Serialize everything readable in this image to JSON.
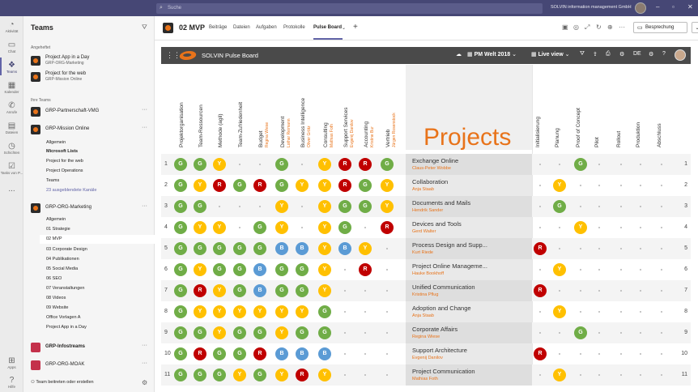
{
  "topbar": {
    "search_placeholder": "Suche",
    "org": "SOLVIN information management GmbH"
  },
  "rail": [
    {
      "label": "Aktivität",
      "icon": "bell-icon"
    },
    {
      "label": "Chat",
      "icon": "chat-icon"
    },
    {
      "label": "Teams",
      "icon": "teams-icon"
    },
    {
      "label": "Kalender",
      "icon": "calendar-icon"
    },
    {
      "label": "Anrufe",
      "icon": "phone-icon"
    },
    {
      "label": "Dateien",
      "icon": "files-icon"
    },
    {
      "label": "Schichten",
      "icon": "shifts-icon"
    },
    {
      "label": "Tasks von P...",
      "icon": "tasks-icon"
    },
    {
      "label": "...",
      "icon": "more-icon"
    },
    {
      "label": "Apps",
      "icon": "apps-icon"
    },
    {
      "label": "Hilfe",
      "icon": "help-icon"
    }
  ],
  "teams_panel": {
    "title": "Teams",
    "pinned_label": "Angeheftet",
    "pinned": [
      {
        "name": "Project App in a Day",
        "sub": "GRP-ORG-Marketing"
      },
      {
        "name": "Project for the web",
        "sub": "GRP-Mission Online"
      }
    ],
    "your_teams_label": "Ihre Teams",
    "team1": "GRP-Partnerschaft-VMG",
    "team2": "GRP-Mission Online",
    "team2_channels": [
      "Allgemein",
      "Microsoft Lists",
      "Project for the web",
      "Project Operations",
      "Teams",
      "23 ausgeblendete Kanäle"
    ],
    "team3": "GRP-ORG-Marketing",
    "team3_channels": [
      "Allgemein",
      "01 Strategie",
      "02 MVP",
      "03 Corporate Design",
      "04 Publikationen",
      "05 Social Media",
      "06 SEO",
      "07 Veranstaltungen",
      "08 Videos",
      "09 Website",
      "Office Vorlagen A",
      "Project App in a Day"
    ],
    "team4": "GRP-Infostreams",
    "team5": "GRP-ORG-MOAK",
    "join": "Team beitreten oder erstellen"
  },
  "header": {
    "title": "02 MVP",
    "tabs": [
      "Beiträge",
      "Dateien",
      "Aufgaben",
      "Protokolle",
      "Pulse Board"
    ],
    "meeting": "Besprechung"
  },
  "pulse": {
    "title": "SOLVIN Pulse Board",
    "portfolio": "PM Welt 2018",
    "view": "Live view",
    "lang": "DE",
    "projects_heading": "Projects",
    "columns": [
      {
        "label": "Projektorganisation",
        "person": ""
      },
      {
        "label": "Team-Ressourcen",
        "person": ""
      },
      {
        "label": "Methode (agil)",
        "person": ""
      },
      {
        "label": "Team-Zufriedenheit",
        "person": ""
      },
      {
        "label": "Budget",
        "person": "Regina Wiese"
      },
      {
        "label": "Development",
        "person": "Lothar Reimann"
      },
      {
        "label": "Business Intelligence",
        "person": "Oliver Grötz"
      },
      {
        "label": "Consulting",
        "person": "Mathias Foth"
      },
      {
        "label": "Support Services",
        "person": "Evgenij Danilov"
      },
      {
        "label": "Accounting",
        "person": "Kristine Bur"
      },
      {
        "label": "Vertrieb",
        "person": "Jürgen Rosenstock"
      }
    ],
    "phases": [
      "Initialisierung",
      "Planung",
      "Proof of Concept",
      "Pilot",
      "Rollout",
      "Produktion",
      "Abschluss"
    ],
    "rows": [
      {
        "n": "1",
        "name": "Exchange Online",
        "pm": "Claus-Peter Wobbe",
        "cells": [
          "G",
          "G",
          "Y",
          "",
          "",
          "G",
          "",
          "Y",
          "R",
          "R",
          "G"
        ],
        "phase": [
          "",
          "",
          "G",
          "",
          "",
          "",
          ""
        ]
      },
      {
        "n": "2",
        "name": "Collaboration",
        "pm": "Anja Staab",
        "cells": [
          "G",
          "Y",
          "R",
          "G",
          "R",
          "G",
          "Y",
          "Y",
          "R",
          "G",
          "Y"
        ],
        "phase": [
          "",
          "Y",
          "",
          "",
          "",
          "",
          ""
        ]
      },
      {
        "n": "3",
        "name": "Documents and Mails",
        "pm": "Hendrik Sander",
        "cells": [
          "G",
          "G",
          "",
          "",
          "",
          "Y",
          "",
          "Y",
          "G",
          "G",
          "Y"
        ],
        "phase": [
          "",
          "G",
          "",
          "",
          "",
          "",
          ""
        ]
      },
      {
        "n": "4",
        "name": "Devices and Tools",
        "pm": "Gerd Walter",
        "cells": [
          "G",
          "Y",
          "Y",
          "",
          "G",
          "Y",
          "",
          "Y",
          "G",
          "",
          "R"
        ],
        "phase": [
          "",
          "",
          "Y",
          "",
          "",
          "",
          ""
        ]
      },
      {
        "n": "5",
        "name": "Process Design and Supp...",
        "pm": "Kurt Riede",
        "cells": [
          "G",
          "G",
          "G",
          "G",
          "G",
          "B",
          "B",
          "Y",
          "B",
          "Y",
          ""
        ],
        "phase": [
          "R",
          "",
          "",
          "",
          "",
          "",
          ""
        ]
      },
      {
        "n": "6",
        "name": "Project Online Manageme...",
        "pm": "Hauke Bookhoff",
        "cells": [
          "G",
          "Y",
          "G",
          "G",
          "B",
          "G",
          "G",
          "Y",
          "",
          "R",
          ""
        ],
        "phase": [
          "",
          "Y",
          "",
          "",
          "",
          "",
          ""
        ]
      },
      {
        "n": "7",
        "name": "Unified Communication",
        "pm": "Kristina Pflug",
        "cells": [
          "G",
          "R",
          "Y",
          "G",
          "B",
          "G",
          "G",
          "Y",
          "",
          "",
          ""
        ],
        "phase": [
          "R",
          "",
          "",
          "",
          "",
          "",
          ""
        ]
      },
      {
        "n": "8",
        "name": "Adoption and Change",
        "pm": "Anja Staab",
        "cells": [
          "G",
          "Y",
          "Y",
          "Y",
          "Y",
          "Y",
          "Y",
          "G",
          "",
          "",
          ""
        ],
        "phase": [
          "",
          "Y",
          "",
          "",
          "",
          "",
          ""
        ]
      },
      {
        "n": "9",
        "name": "Corporate Affairs",
        "pm": "Regina Wiese",
        "cells": [
          "G",
          "G",
          "Y",
          "G",
          "G",
          "Y",
          "G",
          "G",
          "",
          "",
          ""
        ],
        "phase": [
          "",
          "",
          "G",
          "",
          "",
          "",
          ""
        ]
      },
      {
        "n": "10",
        "name": "Support Architecture",
        "pm": "Evgenij Danilov",
        "cells": [
          "G",
          "R",
          "G",
          "G",
          "R",
          "B",
          "B",
          "B",
          "",
          "",
          ""
        ],
        "phase": [
          "R",
          "",
          "",
          "",
          "",
          "",
          ""
        ]
      },
      {
        "n": "11",
        "name": "Project Communication",
        "pm": "Mathias Foth",
        "cells": [
          "G",
          "G",
          "G",
          "Y",
          "G",
          "Y",
          "R",
          "Y",
          "",
          "",
          ""
        ],
        "phase": [
          "",
          "Y",
          "",
          "",
          "",
          "",
          ""
        ]
      }
    ]
  },
  "colors": {
    "green": "#70ad47",
    "yellow": "#ffc000",
    "red": "#c00000",
    "blue": "#5b9bd5",
    "accent": "#e8731a",
    "teams": "#464775"
  }
}
